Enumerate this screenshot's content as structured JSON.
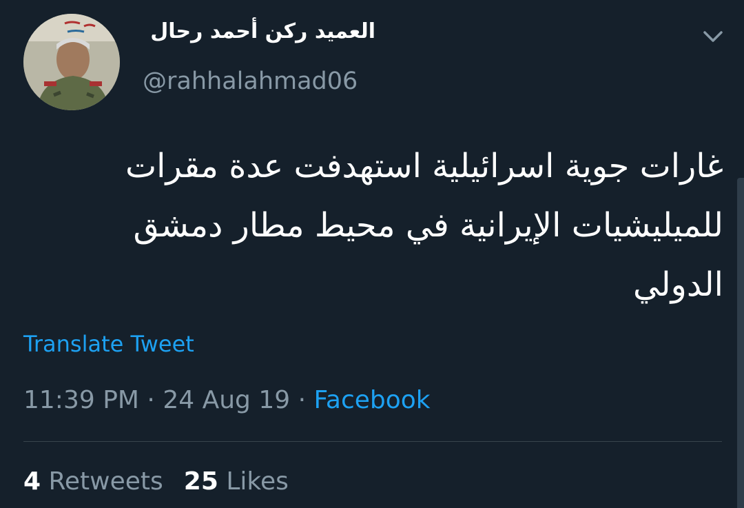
{
  "user": {
    "display_name": "العميد ركن أحمد رحال",
    "handle": "@rahhalahmad06",
    "avatar_icon": "profile-photo"
  },
  "tweet": {
    "text": "غارات جوية اسرائيلية استهدفت عدة مقرات للميليشيات الإيرانية في محيط مطار دمشق الدولي",
    "translate_label": "Translate Tweet",
    "time": "11:39 PM",
    "date": "24 Aug 19",
    "separator": "·",
    "source": "Facebook"
  },
  "stats": {
    "retweets_count": "4",
    "retweets_label": "Retweets",
    "likes_count": "25",
    "likes_label": "Likes"
  },
  "colors": {
    "background": "#15202b",
    "primary_text": "#ffffff",
    "secondary_text": "#8899a6",
    "accent": "#1da1f2",
    "divider": "#38444d"
  },
  "icons": {
    "menu": "chevron-down-icon"
  }
}
